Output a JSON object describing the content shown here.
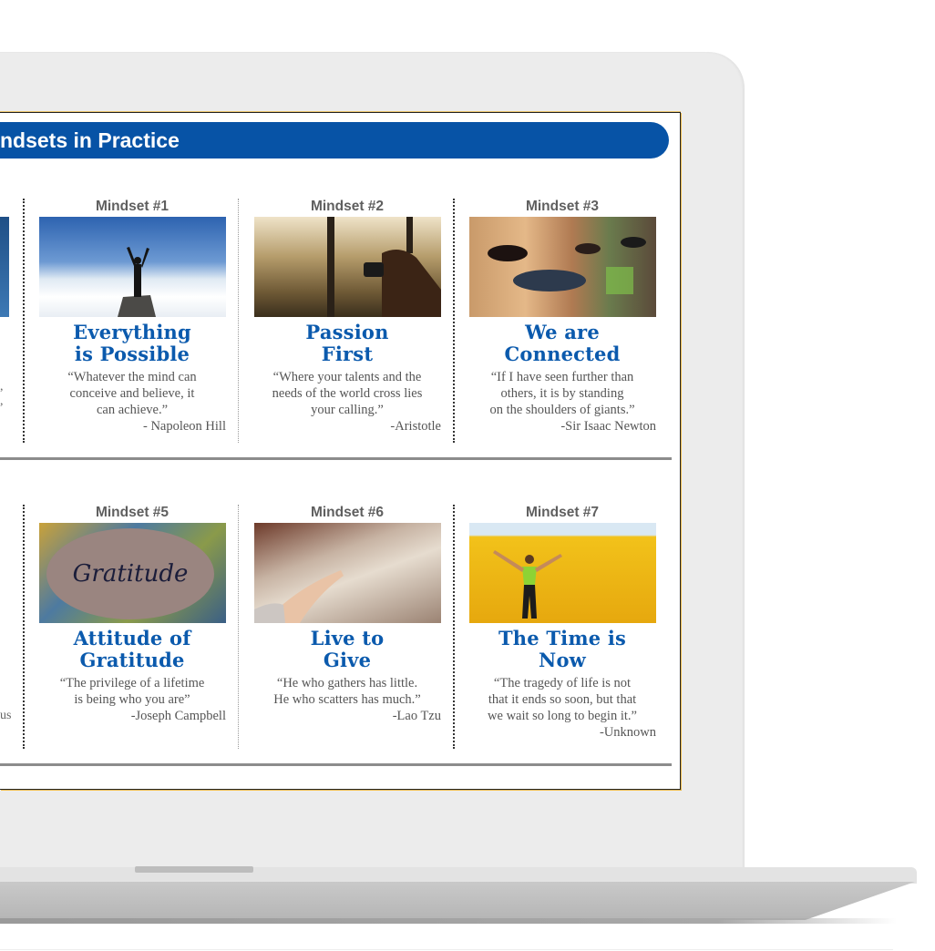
{
  "header": {
    "title": "ndsets in Practice"
  },
  "colors": {
    "brand_blue": "#0753a6",
    "title_blue": "#0b5aad",
    "label_gray": "#5f5f5f",
    "screen_border_gold": "#e9b94a"
  },
  "row1": [
    {
      "label": "Mindset #1",
      "image": "person-on-mountain-above-clouds",
      "title_l1": "Everything",
      "title_l2": "is Possible",
      "quote": "“Whatever the mind can\nconceive and believe, it\ncan achieve.”",
      "author": "- Napoleon Hill"
    },
    {
      "label": "Mindset #2",
      "image": "photographer-at-window-city",
      "title_l1": "Passion",
      "title_l2": "First",
      "quote": "“Where your talents and the\nneeds of the world cross lies\nyour calling.”",
      "author": "-Aristotle"
    },
    {
      "label": "Mindset #3",
      "image": "group-of-friends-smiling",
      "title_l1": "We are",
      "title_l2": "Connected",
      "quote": "“If I have seen further than\nothers, it is by standing\non the shoulders of giants.”",
      "author": "-Sir Isaac Newton"
    }
  ],
  "row2": [
    {
      "label": "Mindset #5",
      "image": "gratitude-stone",
      "stone_text": "Gratitude",
      "title_l1": "Attitude of",
      "title_l2": "Gratitude",
      "quote": "“The privilege of a lifetime\nis being who you are”",
      "author": "-Joseph Campbell"
    },
    {
      "label": "Mindset #6",
      "image": "hands-releasing-sparkles",
      "title_l1": "Live to",
      "title_l2": "Give",
      "quote": "“He who gathers has little.\nHe who scatters has much.”",
      "author": "-Lao Tzu"
    },
    {
      "label": "Mindset #7",
      "image": "woman-in-yellow-field",
      "title_l1": "The Time is",
      "title_l2": "Now",
      "quote": "“The tragedy of life is not\nthat it ends so soon, but that\nwe wait so long to begin it.”",
      "author": "-Unknown"
    }
  ],
  "partial": {
    "row1_fragment_a": ",",
    "row1_fragment_b": ",",
    "row2_fragment": "us"
  }
}
